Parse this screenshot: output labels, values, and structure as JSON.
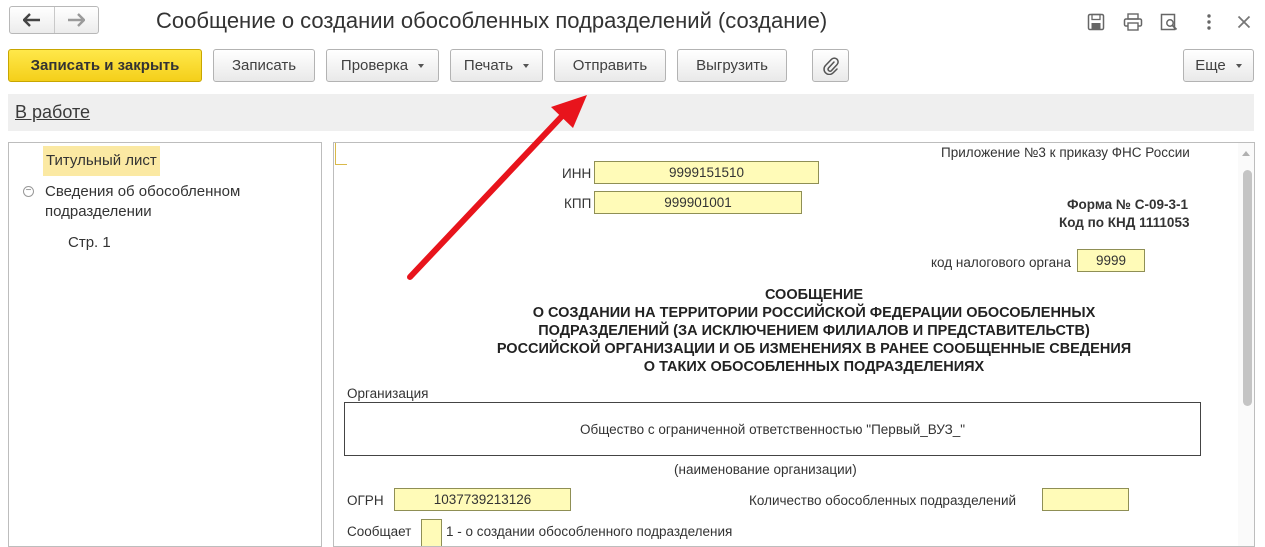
{
  "window": {
    "title": "Сообщение о создании обособленных подразделений  (создание)"
  },
  "toolbar": {
    "save_close_label": "Записать и закрыть",
    "save_label": "Записать",
    "check_label": "Проверка",
    "print_label": "Печать",
    "send_label": "Отправить",
    "export_label": "Выгрузить",
    "more_label": "Еще"
  },
  "status": {
    "label": "В работе"
  },
  "tree": {
    "items": [
      {
        "label": "Титульный лист",
        "selected": true
      },
      {
        "label": "Сведения об обособленном подразделении"
      },
      {
        "label": "Стр. 1"
      }
    ]
  },
  "form": {
    "appendix": "Приложение №3 к приказу ФНС России",
    "inn_label": "ИНН",
    "inn_value": "9999151510",
    "kpp_label": "КПП",
    "kpp_value": "999901001",
    "form_number": "Форма № С-09-3-1",
    "knd_code": "Код по КНД 1111053",
    "tax_office_label": "код налогового органа",
    "tax_office_value": "9999",
    "heading_lines": [
      "СООБЩЕНИЕ",
      "О СОЗДАНИИ НА ТЕРРИТОРИИ РОССИЙСКОЙ ФЕДЕРАЦИИ ОБОСОБЛЕННЫХ",
      "ПОДРАЗДЕЛЕНИЙ (ЗА ИСКЛЮЧЕНИЕМ ФИЛИАЛОВ И ПРЕДСТАВИТЕЛЬСТВ)",
      "РОССИЙСКОЙ ОРГАНИЗАЦИИ И ОБ ИЗМЕНЕНИЯХ В РАНЕЕ СООБЩЕННЫЕ СВЕДЕНИЯ",
      "О ТАКИХ ОБОСОБЛЕННЫХ ПОДРАЗДЕЛЕНИЯХ"
    ],
    "org_label": "Организация",
    "org_value": "Общество с ограниченной ответственностью \"Первый_ВУЗ_\"",
    "org_caption": "(наименование организации)",
    "ogrn_label": "ОГРН",
    "ogrn_value": "1037739213126",
    "units_count_label": "Количество обособленных подразделений",
    "units_count_value": "",
    "reports_label": "Сообщает",
    "reports_value": "",
    "reports_option": "1 - о создании обособленного подразделения"
  },
  "colors": {
    "primary_button": "#f4cf1a",
    "field_fill": "#fffbb8",
    "selected_tree_item": "#fbe9a3",
    "annotation_arrow": "#e8141c"
  },
  "icons": [
    "back-arrow-icon",
    "forward-arrow-icon",
    "save-icon",
    "print-icon",
    "preview-icon",
    "more-vertical-icon",
    "close-icon",
    "paperclip-icon",
    "collapse-icon"
  ]
}
